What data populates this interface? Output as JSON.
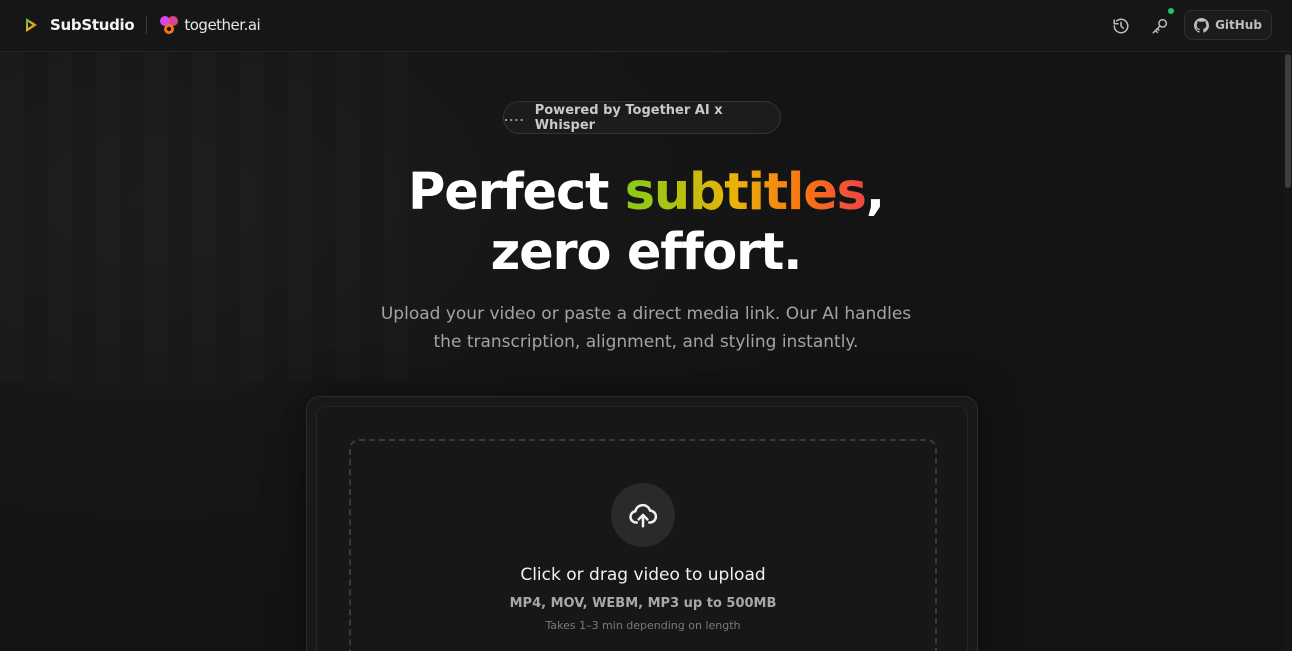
{
  "header": {
    "brand_name": "SubStudio",
    "partner_name": "together.ai",
    "github_label": "GitHub",
    "icons": {
      "brand": "play-icon",
      "partner": "together-logo-icon",
      "history": "history-icon",
      "key": "key-icon",
      "github": "github-icon"
    },
    "status_color": "#22c55e"
  },
  "hero": {
    "pill_dots": "....",
    "pill_text": "Powered by Together AI x Whisper",
    "headline_prefix": "Perfect ",
    "headline_highlight": "subtitles",
    "headline_comma": ",",
    "headline_line2": "zero effort.",
    "subtitle_line1": "Upload your video or paste a direct media link. Our AI handles",
    "subtitle_line2": "the transcription, alignment, and styling instantly.",
    "gradient_colors": [
      "#84cc16",
      "#eab308",
      "#f97316",
      "#ef4444"
    ]
  },
  "upload": {
    "icon": "cloud-upload-icon",
    "title": "Click or drag video to upload",
    "formats": "MP4, MOV, WEBM, MP3 up to 500MB",
    "note": "Takes 1–3 min depending on length"
  }
}
